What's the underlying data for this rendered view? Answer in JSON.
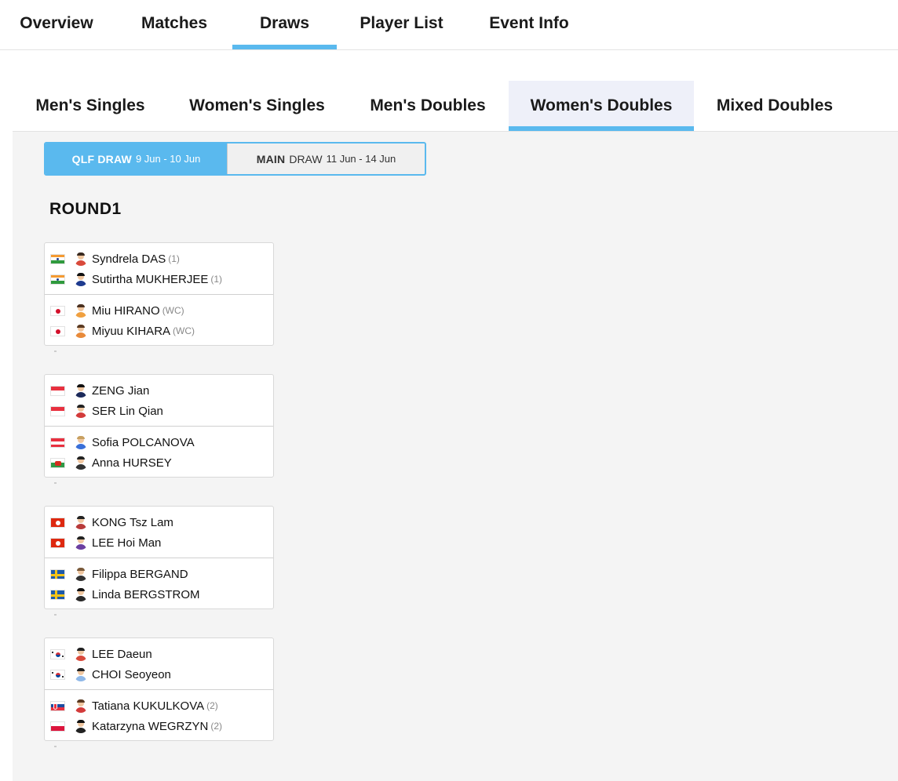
{
  "top_tabs": [
    {
      "label": "Overview"
    },
    {
      "label": "Matches"
    },
    {
      "label": "Draws"
    },
    {
      "label": "Player List"
    },
    {
      "label": "Event Info"
    }
  ],
  "active_top_tab": "Draws",
  "event_tabs": [
    {
      "label": "Men's Singles"
    },
    {
      "label": "Women's Singles"
    },
    {
      "label": "Men's Doubles"
    },
    {
      "label": "Women's Doubles"
    },
    {
      "label": "Mixed Doubles"
    }
  ],
  "active_event_tab": "Women's Doubles",
  "draw_toggle": {
    "qlf": {
      "name": "QLF DRAW",
      "dates": "9 Jun - 10 Jun"
    },
    "main": {
      "name_bold": "MAIN",
      "name_rest": "DRAW",
      "dates": "11 Jun - 14 Jun"
    }
  },
  "round_title": "ROUND1",
  "matches": [
    {
      "teams": [
        {
          "players": [
            {
              "name": "Syndrela DAS",
              "seed": "(1)",
              "flag": "india",
              "avatar": "female-player-icon"
            },
            {
              "name": "Sutirtha MUKHERJEE",
              "seed": "(1)",
              "flag": "india",
              "avatar": "female-player-icon"
            }
          ]
        },
        {
          "players": [
            {
              "name": "Miu HIRANO",
              "seed": "(WC)",
              "flag": "japan",
              "avatar": "female-player-icon"
            },
            {
              "name": "Miyuu KIHARA",
              "seed": "(WC)",
              "flag": "japan",
              "avatar": "female-player-icon"
            }
          ]
        }
      ]
    },
    {
      "teams": [
        {
          "players": [
            {
              "name": "ZENG Jian",
              "seed": "",
              "flag": "singapore",
              "avatar": "female-player-icon"
            },
            {
              "name": "SER Lin Qian",
              "seed": "",
              "flag": "singapore",
              "avatar": "female-player-icon"
            }
          ]
        },
        {
          "players": [
            {
              "name": "Sofia POLCANOVA",
              "seed": "",
              "flag": "austria",
              "avatar": "female-player-icon"
            },
            {
              "name": "Anna HURSEY",
              "seed": "",
              "flag": "wales",
              "avatar": "female-player-icon"
            }
          ]
        }
      ]
    },
    {
      "teams": [
        {
          "players": [
            {
              "name": "KONG Tsz Lam",
              "seed": "",
              "flag": "hong-kong",
              "avatar": "female-player-icon"
            },
            {
              "name": "LEE Hoi Man",
              "seed": "",
              "flag": "hong-kong",
              "avatar": "female-player-icon"
            }
          ]
        },
        {
          "players": [
            {
              "name": "Filippa BERGAND",
              "seed": "",
              "flag": "sweden",
              "avatar": "female-player-icon"
            },
            {
              "name": "Linda BERGSTROM",
              "seed": "",
              "flag": "sweden",
              "avatar": "female-player-icon"
            }
          ]
        }
      ]
    },
    {
      "teams": [
        {
          "players": [
            {
              "name": "LEE Daeun",
              "seed": "",
              "flag": "korea",
              "avatar": "female-player-icon"
            },
            {
              "name": "CHOI Seoyeon",
              "seed": "",
              "flag": "korea",
              "avatar": "female-player-icon"
            }
          ]
        },
        {
          "players": [
            {
              "name": "Tatiana KUKULKOVA",
              "seed": "(2)",
              "flag": "slovakia",
              "avatar": "female-player-icon"
            },
            {
              "name": "Katarzyna WEGRZYN",
              "seed": "(2)",
              "flag": "poland",
              "avatar": "female-player-icon"
            }
          ]
        }
      ]
    }
  ],
  "colors": {
    "accent": "#5ab9ee",
    "active_tab_bg": "#eef0f9",
    "panel_bg": "#f4f4f4",
    "seed_text": "#888888"
  }
}
